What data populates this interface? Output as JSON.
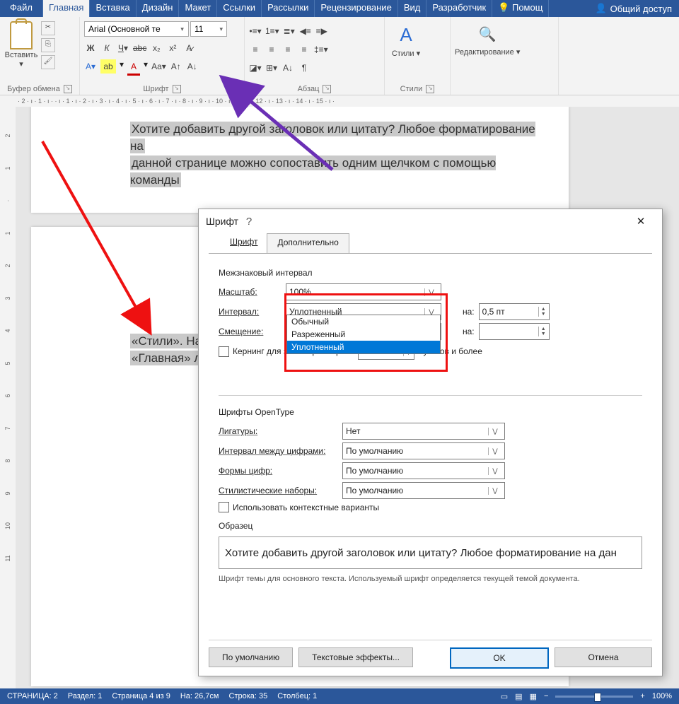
{
  "tabs": {
    "file": "Файл",
    "items": [
      "Главная",
      "Вставка",
      "Дизайн",
      "Макет",
      "Ссылки",
      "Рассылки",
      "Рецензирование",
      "Вид",
      "Разработчик"
    ],
    "help": "Помощ",
    "share": "Общий доступ"
  },
  "ribbon": {
    "clipboard": {
      "paste": "Вставить",
      "label": "Буфер обмена"
    },
    "font": {
      "name": "Arial (Основной те",
      "size": "11",
      "label": "Шрифт"
    },
    "para": {
      "label": "Абзац"
    },
    "styles": {
      "btn": "Стили",
      "label": "Стили"
    },
    "edit": {
      "label": "Редактирование"
    }
  },
  "ruler": "· 2 · ı · 1 · ı ·   · ı · 1 · ı · 2 · ı · 3 · ı · 4 · ı · 5 · ı · 6 · ı · 7 · ı · 8 · ı · 9 · ı · 10 · ı · 11 · ı · 12 · ı · 13 · ı · 14 · ı · 15 · ı ·",
  "vruler_marks": [
    "2",
    "1",
    "",
    "1",
    "2",
    "3",
    "4",
    "5",
    "6",
    "7",
    "8",
    "9",
    "10",
    "11"
  ],
  "doc": {
    "line1": "Хотите добавить другой заголовок или цитату? Любое форматирование на",
    "line2": "данной странице можно сопоставить одним щелчком с помощью команды",
    "line3": "«Стили». На",
    "line4": "«Главная» л"
  },
  "dlg": {
    "title": "Шрифт",
    "tab_font": "Шрифт",
    "tab_adv": "Дополнительно",
    "sect1": "Межзнаковый интервал",
    "scale_l": "Масштаб:",
    "scale_v": "100%",
    "interval_l": "Интервал:",
    "interval_v": "Уплотненный",
    "interval_na": "на:",
    "interval_nv": "0,5 пт",
    "offset_l": "Смещение:",
    "offset_na": "на:",
    "kern": "Кернинг для знаков размером:",
    "kern_suffix": "пунктов и более",
    "dd": [
      "Обычный",
      "Разреженный",
      "Уплотненный"
    ],
    "sect2": "Шрифты OpenType",
    "lig_l": "Лигатуры:",
    "lig_v": "Нет",
    "numint_l": "Интервал между цифрами:",
    "numint_v": "По умолчанию",
    "numform_l": "Формы цифр:",
    "numform_v": "По умолчанию",
    "styl_l": "Стилистические наборы:",
    "styl_v": "По умолчанию",
    "ctx": "Использовать контекстные варианты",
    "sample_l": "Образец",
    "sample": "Хотите добавить другой заголовок или цитату? Любое форматирование на дан",
    "hint": "Шрифт темы для основного текста. Используемый шрифт определяется текущей темой документа.",
    "btn_def": "По умолчанию",
    "btn_fx": "Текстовые эффекты...",
    "btn_ok": "OK",
    "btn_cancel": "Отмена"
  },
  "status": {
    "page": "СТРАНИЦА: 2",
    "sect": "Раздел: 1",
    "pages": "Страница 4 из 9",
    "pos": "На: 26,7см",
    "line": "Строка: 35",
    "col": "Столбец: 1",
    "zoom": "100%"
  }
}
